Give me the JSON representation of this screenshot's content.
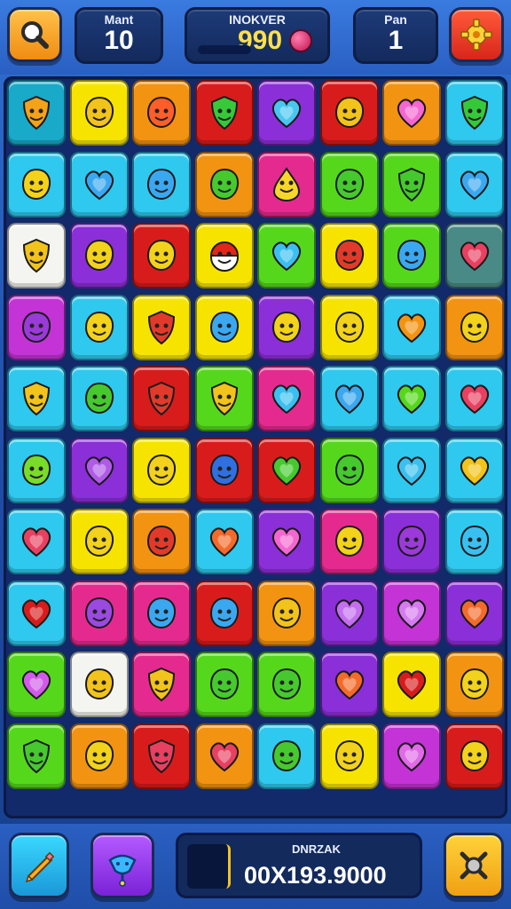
{
  "hud": {
    "moves": {
      "label": "Mant",
      "value": "10"
    },
    "score": {
      "label": "INOKVER",
      "value": "990"
    },
    "level": {
      "label": "Pan",
      "value": "1"
    }
  },
  "footer": {
    "label": "DNRZAK",
    "value": "00X193.9000"
  },
  "icons": {
    "search": "magnifier-icon",
    "settings": "gear-icon",
    "pencil": "pencil-icon",
    "booster": "magic-hand-icon",
    "shuffle": "shuffle-icon"
  },
  "colors": {
    "teal": "#19a9c9",
    "yellow": "#f6e400",
    "orange": "#f39312",
    "red": "#d81c1c",
    "purple": "#8b2fd8",
    "cyan": "#2fc8ee",
    "green": "#55d81c",
    "pink": "#e52a8f",
    "white": "#f4f4f0",
    "magenta": "#c333d6",
    "slate": "#4a8a86"
  },
  "board": {
    "rows": [
      [
        [
          "teal",
          "shield",
          "#f4a21a"
        ],
        [
          "yellow",
          "blob",
          "#f2c31a"
        ],
        [
          "orange",
          "blob",
          "#ff5e2a"
        ],
        [
          "red",
          "shield",
          "#37c93a"
        ],
        [
          "purple",
          "heart",
          "#48c6f0"
        ],
        [
          "red",
          "blob",
          "#f2c31a"
        ],
        [
          "orange",
          "heart",
          "#f566d0"
        ],
        [
          "cyan",
          "shield",
          "#35c93a"
        ]
      ],
      [
        [
          "cyan",
          "blob",
          "#f2d21a"
        ],
        [
          "cyan",
          "heart",
          "#3aa8f0"
        ],
        [
          "cyan",
          "blob",
          "#3aa8f0"
        ],
        [
          "orange",
          "blob",
          "#46c92e"
        ],
        [
          "pink",
          "drop",
          "#f7d62a"
        ],
        [
          "green",
          "blob",
          "#46c92e"
        ],
        [
          "green",
          "shield",
          "#46c92e"
        ],
        [
          "cyan",
          "heart",
          "#3aa8f0"
        ]
      ],
      [
        [
          "white",
          "shield",
          "#f2c31a"
        ],
        [
          "purple",
          "blob",
          "#f2d21a"
        ],
        [
          "red",
          "blob",
          "#f2d21a"
        ],
        [
          "yellow",
          "ball",
          "#ffffff"
        ],
        [
          "green",
          "heart",
          "#3ac0f0"
        ],
        [
          "yellow",
          "blob",
          "#e23a2a"
        ],
        [
          "green",
          "blob",
          "#3aa8f0"
        ],
        [
          "slate",
          "heart",
          "#e84060"
        ]
      ],
      [
        [
          "magenta",
          "blob",
          "#9a3ad8"
        ],
        [
          "cyan",
          "blob",
          "#f2d21a"
        ],
        [
          "yellow",
          "shield",
          "#e23a2a"
        ],
        [
          "yellow",
          "blob",
          "#3aa8f0"
        ],
        [
          "purple",
          "blob",
          "#f2d21a"
        ],
        [
          "yellow",
          "blob",
          "#f2d21a"
        ],
        [
          "cyan",
          "heart",
          "#f39312"
        ],
        [
          "orange",
          "blob",
          "#f2d21a"
        ]
      ],
      [
        [
          "cyan",
          "shield",
          "#f2c31a"
        ],
        [
          "cyan",
          "blob",
          "#46c92e"
        ],
        [
          "red",
          "shield",
          "#e23a2a"
        ],
        [
          "green",
          "shield",
          "#f2c31a"
        ],
        [
          "pink",
          "heart",
          "#3ac0f0"
        ],
        [
          "cyan",
          "heart",
          "#3aa8f0"
        ],
        [
          "cyan",
          "heart",
          "#55d81c"
        ],
        [
          "cyan",
          "heart",
          "#e84060"
        ]
      ],
      [
        [
          "cyan",
          "blob",
          "#7adc2a"
        ],
        [
          "purple",
          "heart",
          "#b05ae8"
        ],
        [
          "yellow",
          "blob",
          "#f2d21a"
        ],
        [
          "red",
          "blob",
          "#2f6fe0"
        ],
        [
          "red",
          "heart",
          "#46c92e"
        ],
        [
          "green",
          "blob",
          "#46c92e"
        ],
        [
          "cyan",
          "heart",
          "#3ac0f0"
        ],
        [
          "cyan",
          "heart",
          "#f2c31a"
        ]
      ],
      [
        [
          "cyan",
          "heart",
          "#e84060"
        ],
        [
          "yellow",
          "blob",
          "#f2d21a"
        ],
        [
          "orange",
          "blob",
          "#e23a2a"
        ],
        [
          "cyan",
          "heart",
          "#f36a2a"
        ],
        [
          "purple",
          "heart",
          "#f566d0"
        ],
        [
          "pink",
          "blob",
          "#f2d21a"
        ],
        [
          "purple",
          "blob",
          "#9a3ad8"
        ],
        [
          "cyan",
          "blob",
          "#3ac0f0"
        ]
      ],
      [
        [
          "cyan",
          "heart",
          "#d81c1c"
        ],
        [
          "pink",
          "blob",
          "#9a4ae0"
        ],
        [
          "pink",
          "blob",
          "#3aa8f0"
        ],
        [
          "red",
          "blob",
          "#3aa8f0"
        ],
        [
          "orange",
          "blob",
          "#f2c31a"
        ],
        [
          "purple",
          "heart",
          "#c46ef0"
        ],
        [
          "magenta",
          "heart",
          "#d67af0"
        ],
        [
          "purple",
          "heart",
          "#f36a2a"
        ]
      ],
      [
        [
          "green",
          "heart",
          "#d15ae8"
        ],
        [
          "white",
          "blob",
          "#f2c31a"
        ],
        [
          "pink",
          "shield",
          "#f2c31a"
        ],
        [
          "green",
          "blob",
          "#46c92e"
        ],
        [
          "green",
          "blob",
          "#46c92e"
        ],
        [
          "purple",
          "heart",
          "#f36a2a"
        ],
        [
          "yellow",
          "heart",
          "#d81c1c"
        ],
        [
          "orange",
          "blob",
          "#f2d21a"
        ]
      ],
      [
        [
          "green",
          "shield",
          "#46c92e"
        ],
        [
          "orange",
          "blob",
          "#f2d21a"
        ],
        [
          "red",
          "shield",
          "#e84060"
        ],
        [
          "orange",
          "heart",
          "#e84060"
        ],
        [
          "cyan",
          "blob",
          "#46c92e"
        ],
        [
          "yellow",
          "blob",
          "#f2d21a"
        ],
        [
          "magenta",
          "heart",
          "#e06ae8"
        ],
        [
          "red",
          "blob",
          "#f2d21a"
        ]
      ]
    ]
  }
}
